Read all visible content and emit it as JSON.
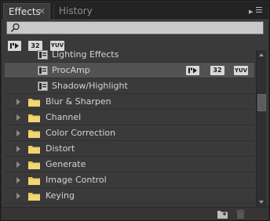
{
  "tabs": [
    {
      "label": "Effects",
      "active": true
    },
    {
      "label": "History",
      "active": false
    }
  ],
  "search": {
    "value": "",
    "placeholder": ""
  },
  "filter_badges": [
    "",
    "32",
    "YUV"
  ],
  "effects_list": [
    {
      "type": "effect",
      "label": "Lighting Effects",
      "selected": false,
      "badges": []
    },
    {
      "type": "effect",
      "label": "ProcAmp",
      "selected": true,
      "badges": [
        "",
        "32",
        "YUV"
      ]
    },
    {
      "type": "effect",
      "label": "Shadow/Highlight",
      "selected": false,
      "badges": []
    },
    {
      "type": "folder",
      "label": "Blur & Sharpen"
    },
    {
      "type": "folder",
      "label": "Channel"
    },
    {
      "type": "folder",
      "label": "Color Correction"
    },
    {
      "type": "folder",
      "label": "Distort"
    },
    {
      "type": "folder",
      "label": "Generate"
    },
    {
      "type": "folder",
      "label": "Image Control"
    },
    {
      "type": "folder",
      "label": "Keying"
    }
  ],
  "colors": {
    "panel_bg": "#3a3a3a",
    "selected_row": "#525252",
    "folder": "#e8c860",
    "badge_bg": "#d8d8d8"
  },
  "icons": {
    "tab_close": "close-icon",
    "panel_menu": "panel-menu-icon",
    "search": "search-icon",
    "accelerated": "accelerated-effect-icon",
    "effect": "effect-preset-icon",
    "folder": "folder-icon",
    "expand": "chevron-right-icon",
    "new_bin": "new-bin-icon",
    "delete": "trash-icon"
  }
}
